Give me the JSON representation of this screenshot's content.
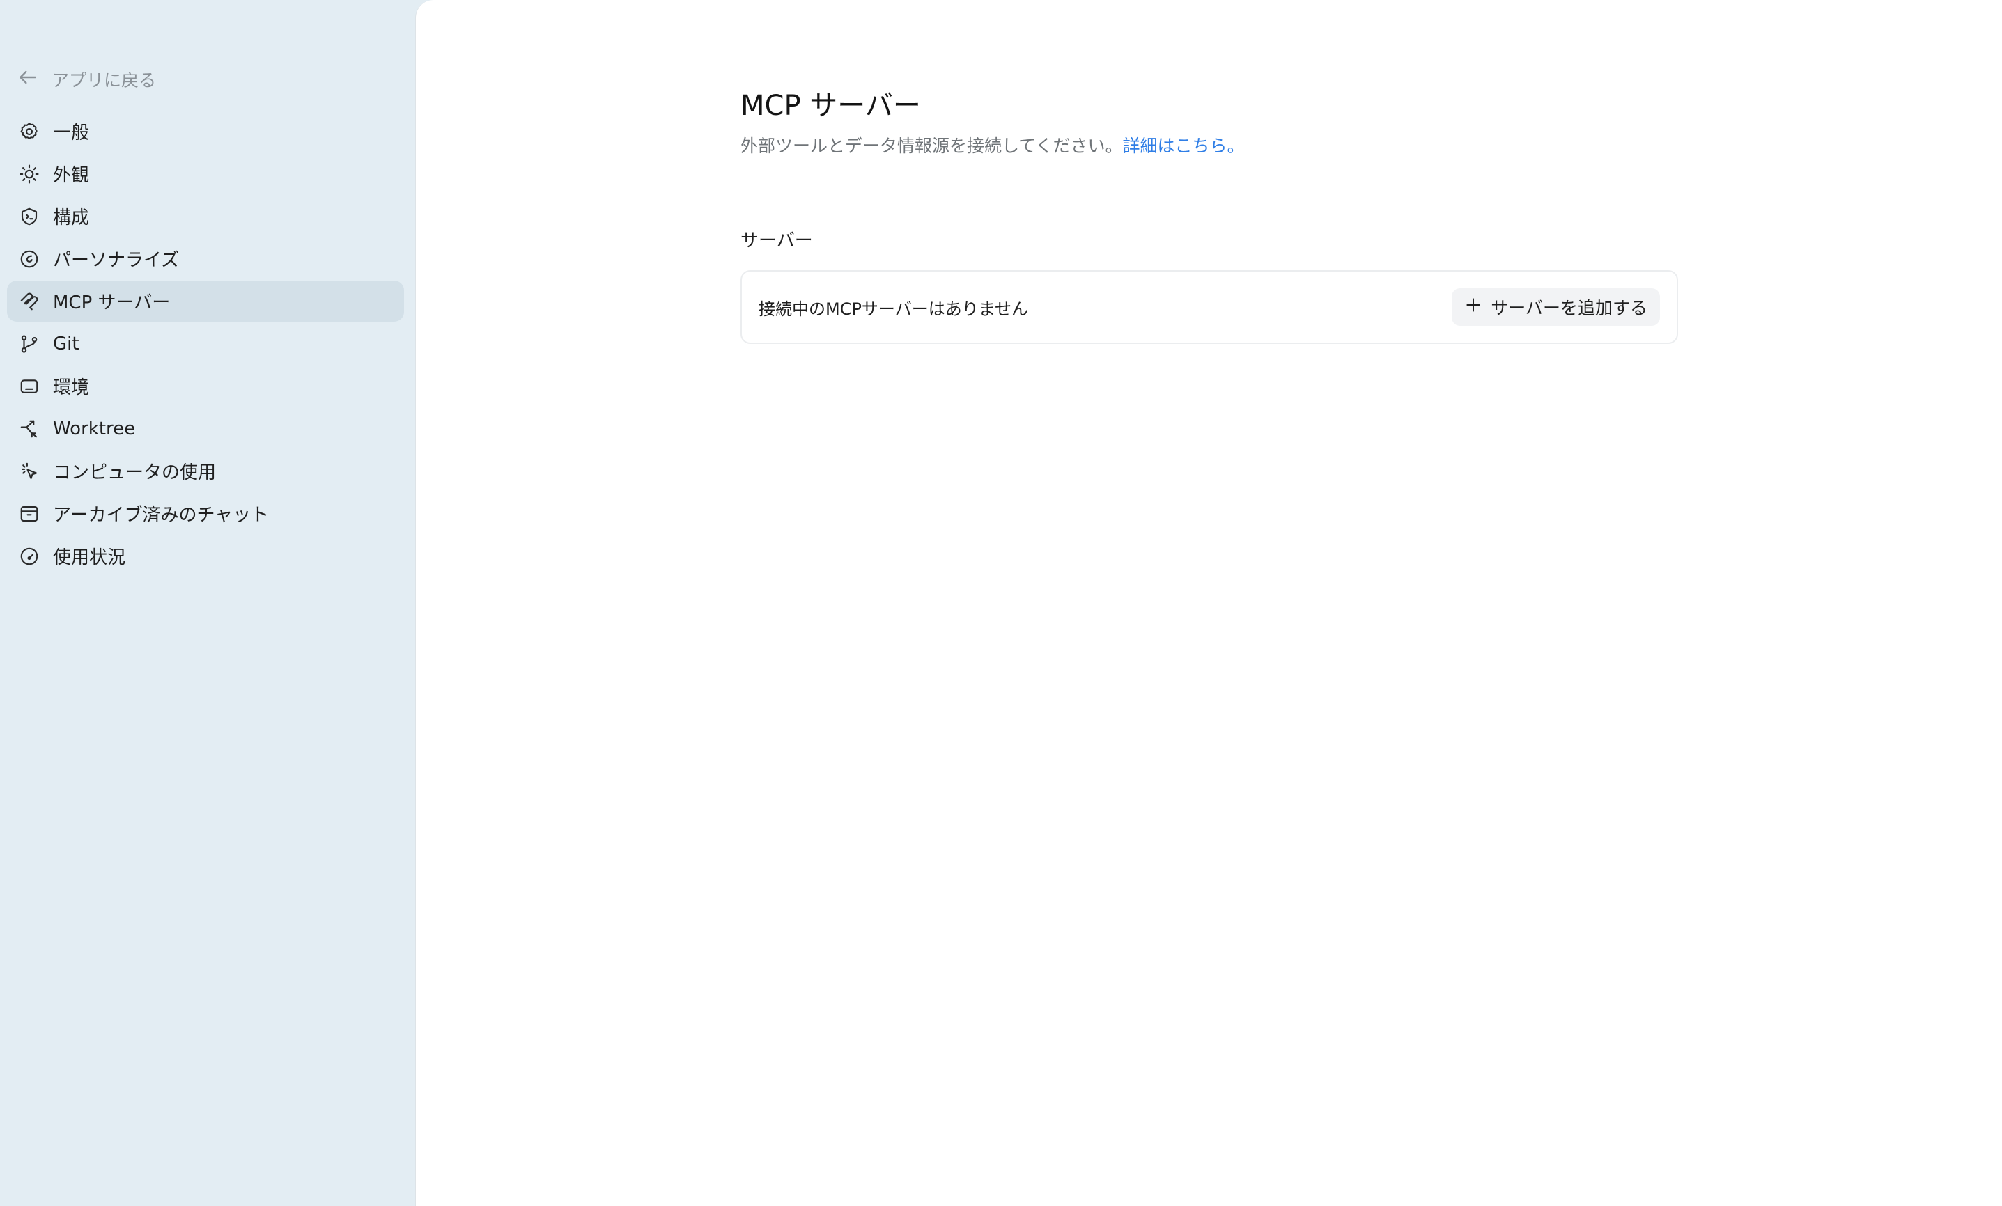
{
  "sidebar": {
    "back_label": "アプリに戻る",
    "back_icon": "arrow-left-icon",
    "items": [
      {
        "label": "一般",
        "icon": "gear-icon"
      },
      {
        "label": "外観",
        "icon": "sun-icon"
      },
      {
        "label": "構成",
        "icon": "shield-code-icon"
      },
      {
        "label": "パーソナライズ",
        "icon": "personalize-icon"
      },
      {
        "label": "MCP サーバー",
        "icon": "mcp-icon",
        "active": true
      },
      {
        "label": "Git",
        "icon": "git-branch-icon"
      },
      {
        "label": "環境",
        "icon": "terminal-icon"
      },
      {
        "label": "Worktree",
        "icon": "worktree-icon"
      },
      {
        "label": "コンピュータの使用",
        "icon": "cursor-click-icon"
      },
      {
        "label": "アーカイブ済みのチャット",
        "icon": "archive-icon"
      },
      {
        "label": "使用状況",
        "icon": "gauge-icon"
      }
    ]
  },
  "main": {
    "title": "MCP サーバー",
    "subtitle": "外部ツールとデータ情報源を接続してください。",
    "learn_more_link": "詳細はこちら。",
    "section_label": "サーバー",
    "empty_message": "接続中のMCPサーバーはありません",
    "add_button_label": "サーバーを追加する",
    "add_button_icon": "plus-icon"
  },
  "colors": {
    "sidebar_bg": "#e3edf3",
    "active_item_bg": "#d3e0e8",
    "link": "#2f7ee6",
    "muted_text": "#6f7478"
  }
}
